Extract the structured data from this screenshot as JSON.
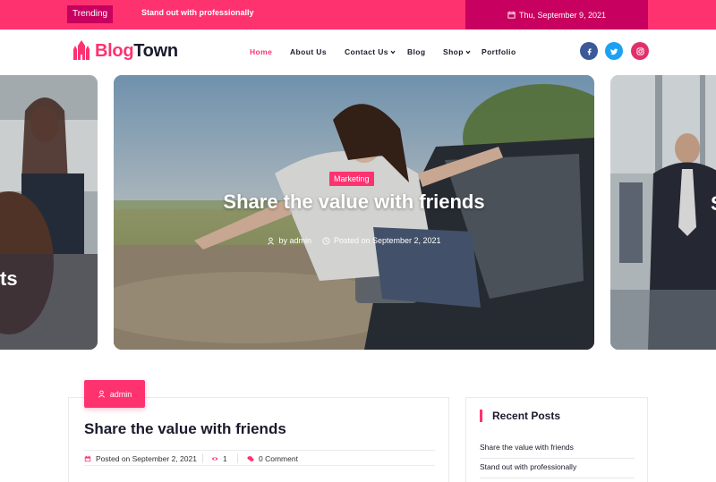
{
  "topbar": {
    "trending_label": "Trending",
    "ticker_text": "Stand out with professionally",
    "date": "Thu, September 9, 2021"
  },
  "header": {
    "logo_part1": "Blog",
    "logo_part2": "Town",
    "nav": [
      {
        "label": "Home",
        "active": true,
        "dropdown": false
      },
      {
        "label": "About Us",
        "active": false,
        "dropdown": false
      },
      {
        "label": "Contact Us",
        "active": false,
        "dropdown": true
      },
      {
        "label": "Blog",
        "active": false,
        "dropdown": false
      },
      {
        "label": "Shop",
        "active": false,
        "dropdown": true
      },
      {
        "label": "Portfolio",
        "active": false,
        "dropdown": false
      }
    ],
    "social": [
      {
        "icon": "facebook-icon",
        "color": "#3b5998"
      },
      {
        "icon": "twitter-icon",
        "color": "#1da1f2"
      },
      {
        "icon": "instagram-icon",
        "color": "#e1306c"
      }
    ]
  },
  "slider": {
    "left_partial_title": "ts",
    "right_partial_title": "S",
    "main": {
      "category": "Marketing",
      "title": "Share the value with friends",
      "author": "by admin",
      "posted": "Posted on September 2, 2021"
    }
  },
  "post": {
    "author_label": "admin",
    "title": "Share the value with friends",
    "posted": "Posted on September 2, 2021",
    "views": "1",
    "comments": "0 Comment"
  },
  "sidebar": {
    "title": "Recent Posts",
    "items": [
      "Share the value with friends",
      "Stand out with professionally"
    ]
  },
  "colors": {
    "accent": "#ff3270",
    "accent_dark": "#c8005f",
    "text": "#1a1a2e"
  }
}
